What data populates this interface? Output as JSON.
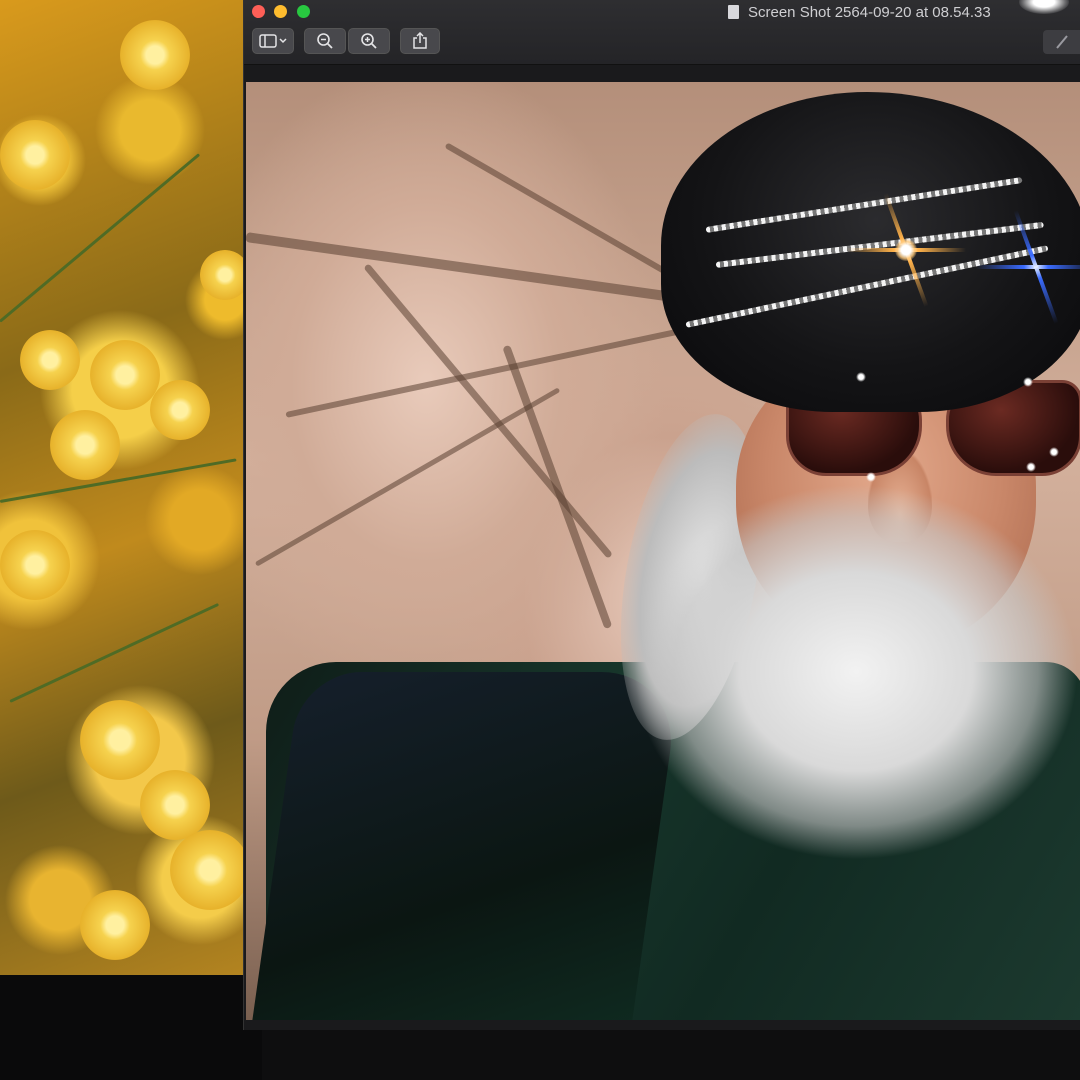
{
  "window": {
    "title": "Screen Shot 2564-09-20 at 08.54.33",
    "doc_icon": "document-icon"
  },
  "toolbar": {
    "buttons": [
      {
        "name": "sidebar-toggle-button",
        "icon": "sidebar-icon"
      },
      {
        "name": "zoom-out-button",
        "icon": "zoom-out-icon"
      },
      {
        "name": "zoom-in-button",
        "icon": "zoom-in-icon"
      },
      {
        "name": "share-button",
        "icon": "share-icon"
      }
    ],
    "edit_icon": "markup-icon"
  },
  "traffic_lights": {
    "close": "#fe5f57",
    "minimize": "#febc2e",
    "maximize": "#28c840"
  },
  "colors": {
    "titlebar": "#2e2e31",
    "wallpaper_accent": "#f3c63a"
  }
}
